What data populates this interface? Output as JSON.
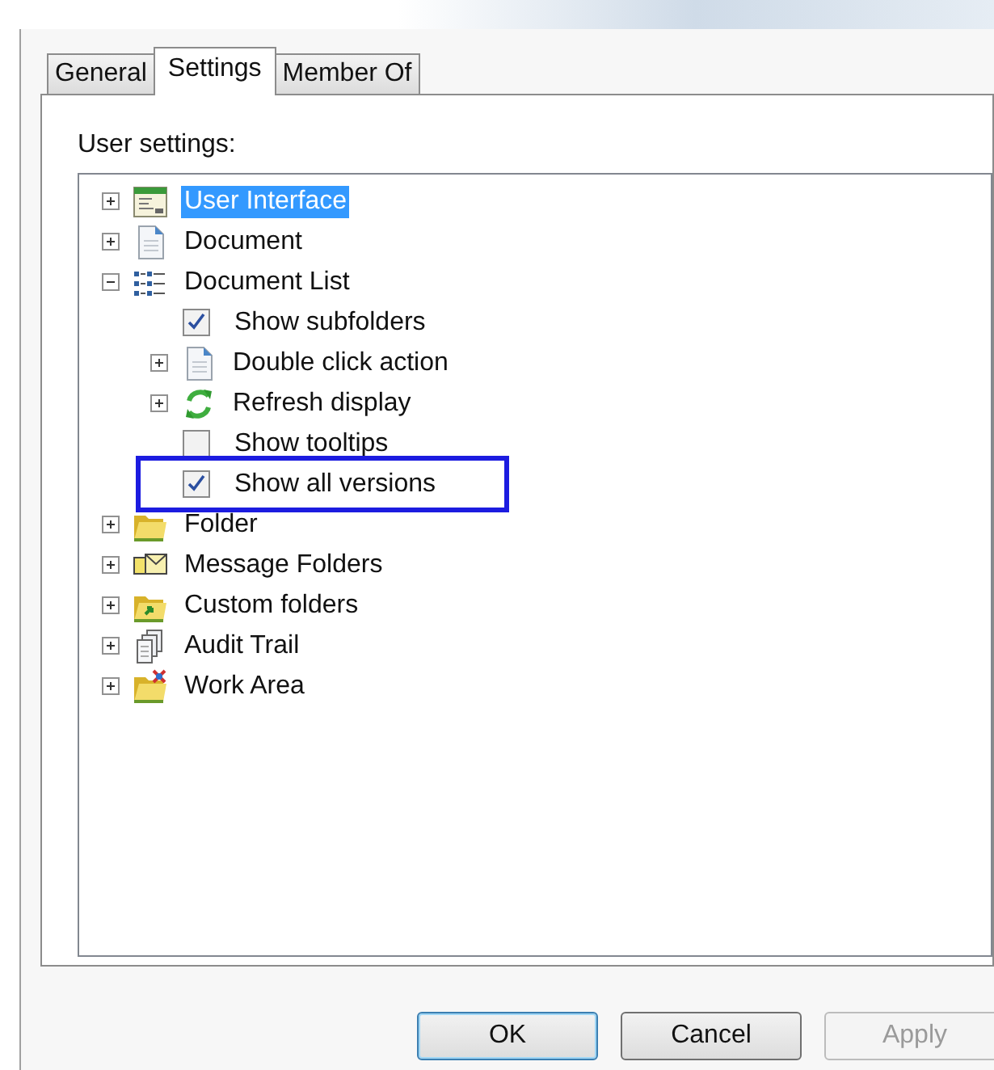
{
  "tabs": [
    {
      "label": "General",
      "selected": false
    },
    {
      "label": "Settings",
      "selected": true
    },
    {
      "label": "Member Of",
      "selected": false
    }
  ],
  "label": "User settings:",
  "tree": [
    {
      "kind": "node",
      "label": "User Interface",
      "expanded": false,
      "selected": true
    },
    {
      "kind": "node",
      "label": "Document",
      "expanded": false,
      "selected": false
    },
    {
      "kind": "node",
      "label": "Document List",
      "expanded": true,
      "selected": false,
      "children": [
        {
          "kind": "checkbox",
          "label": "Show subfolders",
          "checked": true,
          "selected": false
        },
        {
          "kind": "node",
          "label": "Double click action",
          "expanded": false,
          "selected": false
        },
        {
          "kind": "node",
          "label": "Refresh display",
          "expanded": false,
          "selected": false
        },
        {
          "kind": "checkbox",
          "label": "Show tooltips",
          "checked": false,
          "selected": false
        },
        {
          "kind": "checkbox",
          "label": "Show all versions",
          "checked": true,
          "selected": false,
          "highlighted": true
        }
      ]
    },
    {
      "kind": "node",
      "label": "Folder",
      "expanded": false,
      "selected": false
    },
    {
      "kind": "node",
      "label": "Message Folders",
      "expanded": false,
      "selected": false
    },
    {
      "kind": "node",
      "label": "Custom folders",
      "expanded": false,
      "selected": false
    },
    {
      "kind": "node",
      "label": "Audit Trail",
      "expanded": false,
      "selected": false
    },
    {
      "kind": "node",
      "label": "Work Area",
      "expanded": false,
      "selected": false
    }
  ],
  "buttons": [
    {
      "label": "OK",
      "kind": "default",
      "disabled": false
    },
    {
      "label": "Cancel",
      "kind": "normal",
      "disabled": false
    },
    {
      "label": "Apply",
      "kind": "normal",
      "disabled": true
    }
  ]
}
